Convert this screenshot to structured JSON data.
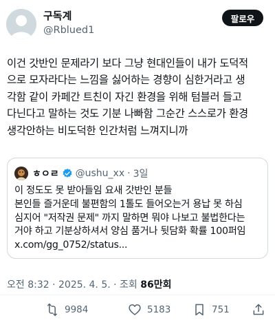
{
  "author": {
    "display_name": "구독계",
    "handle": "@Rblued1"
  },
  "follow_label": "팔로우",
  "tweet_lines": [
    "이건 갓반인 문제라기 보다 그냥 현대인들이 내가 도덕적",
    "으로 모자라다는 느낌을 싫어하는 경향이 심한거라고 생",
    "각함 같이 카페간 트친이 자긴 환경을 위해 텀블러 들고",
    "다닌다고 말하는 것도 기분 나빠함 그순간 스스로가 환경",
    "생각안하는 비도덕한 인간처럼 느껴지니까"
  ],
  "quote": {
    "author_name": "ㅎㅇㄹ",
    "handle": "@ushu_xx",
    "separator": "·",
    "time": "3일",
    "lines": [
      "이 정도도 못 받아들임 요새 갓반인 분들",
      "본인들 즐거운데 불편함의 1톨도 들어오는거 용납 못 하심",
      "심지어 \"저작권 문제\" 까지 말하면 뭐야 나보고 불법한다는",
      "거야 하고 기분상하셔서 양심 품거나 뒷담화 확률 100퍼임",
      "x.com/gg_0752/status..."
    ]
  },
  "meta": {
    "time_date": "오전 8:32 · 2025. 4. 5. · 조회 ",
    "views": "86만회"
  },
  "actions": {
    "retweets": "9984",
    "likes": "5183",
    "bookmarks": "751"
  },
  "icons": {
    "follow_bg": "#0f1419",
    "muted": "#536471",
    "verified": "#1d9bf0"
  }
}
